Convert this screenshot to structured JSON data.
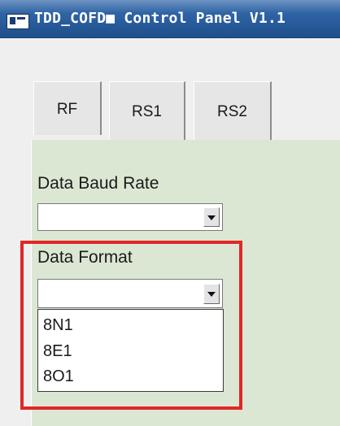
{
  "window": {
    "title": "TDD_COFD■ Control Panel V1.1"
  },
  "tabs": [
    {
      "label": "RF"
    },
    {
      "label": "RS1"
    },
    {
      "label": "RS2"
    }
  ],
  "rs_panel": {
    "baud_rate": {
      "label": "Data Baud Rate",
      "value": ""
    },
    "data_format": {
      "label": "Data Format",
      "value": "",
      "options": [
        "8N1",
        "8E1",
        "8O1"
      ]
    }
  },
  "annotation": {
    "highlight_color": "#e02727"
  },
  "icons": {
    "app": "app-window-icon",
    "dropdown": "chevron-down-icon"
  }
}
